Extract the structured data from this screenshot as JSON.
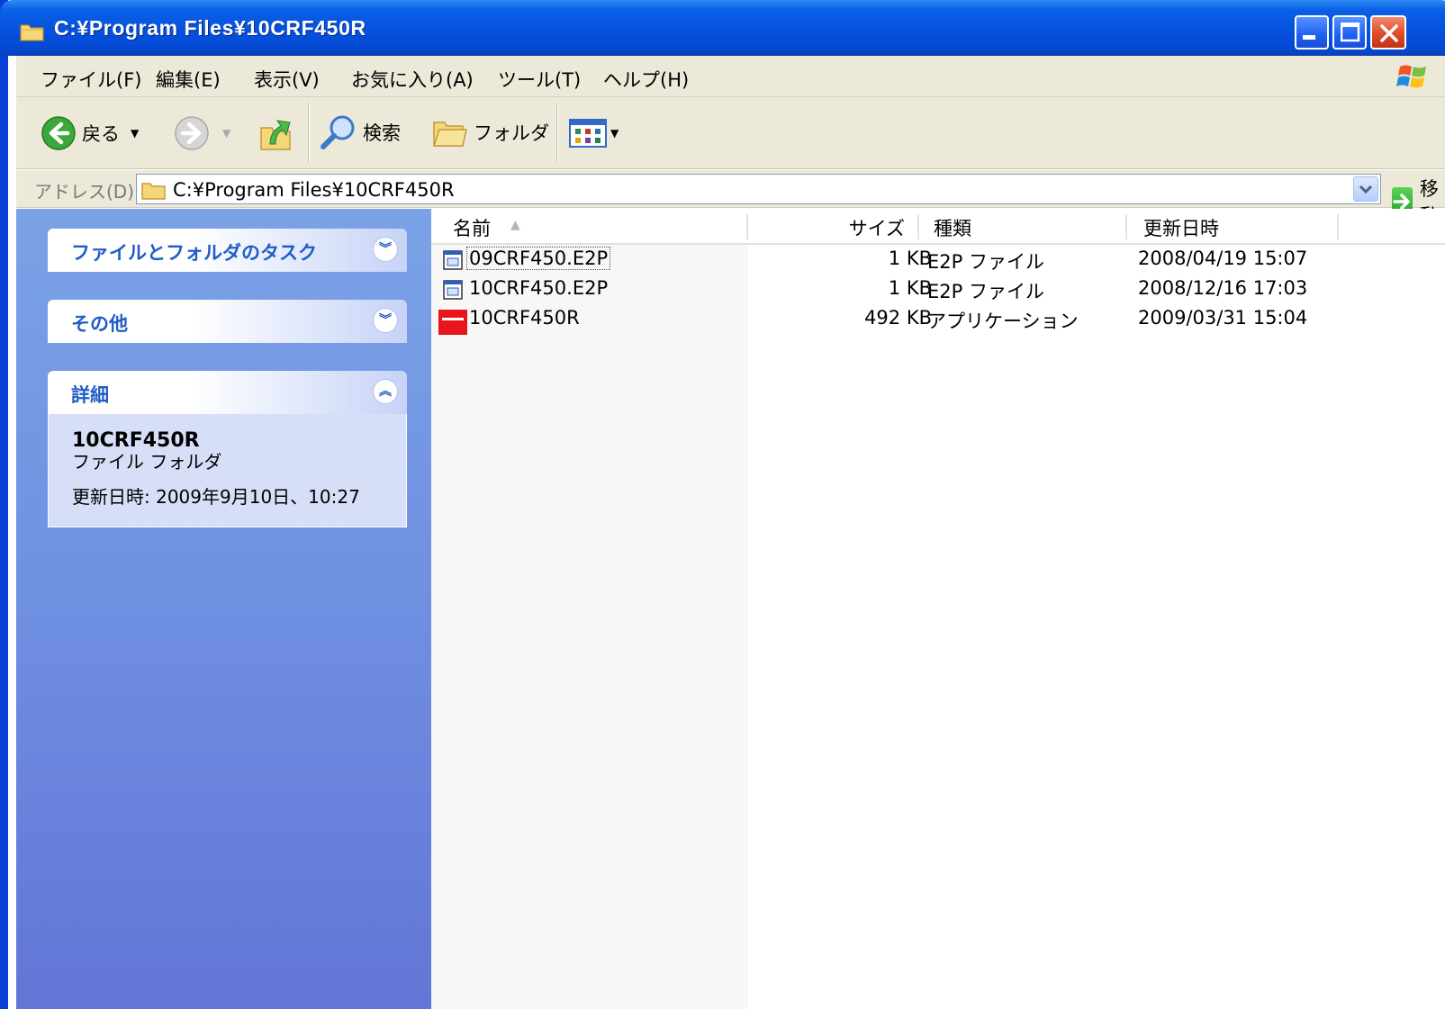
{
  "window": {
    "title": "C:¥Program Files¥10CRF450R"
  },
  "menu": {
    "items": [
      "ファイル(F)",
      "編集(E)",
      "表示(V)",
      "お気に入り(A)",
      "ツール(T)",
      "ヘルプ(H)"
    ]
  },
  "toolbar": {
    "back_label": "戻る",
    "search_label": "検索",
    "folders_label": "フォルダ"
  },
  "address": {
    "label": "アドレス(D)",
    "value": "C:¥Program Files¥10CRF450R",
    "go_label": "移動"
  },
  "taskpane": {
    "panels": [
      {
        "title": "ファイルとフォルダのタスク",
        "expanded": false
      },
      {
        "title": "その他",
        "expanded": false
      },
      {
        "title": "詳細",
        "expanded": true
      }
    ],
    "details": {
      "name": "10CRF450R",
      "type": "ファイル フォルダ",
      "modified": "更新日時: 2009年9月10日、10:27"
    }
  },
  "filelist": {
    "columns": [
      "名前",
      "サイズ",
      "種類",
      "更新日時"
    ],
    "files": [
      {
        "name": "09CRF450.E2P",
        "size": "1 KB",
        "type": "E2P ファイル",
        "modified": "2008/04/19 15:07",
        "icon": "e2p-file-icon"
      },
      {
        "name": "10CRF450.E2P",
        "size": "1 KB",
        "type": "E2P ファイル",
        "modified": "2008/12/16 17:03",
        "icon": "e2p-file-icon"
      },
      {
        "name": "10CRF450R",
        "size": "492 KB",
        "type": "アプリケーション",
        "modified": "2009/03/31 15:04",
        "icon": "application-icon"
      }
    ]
  },
  "colors": {
    "titlebar": "#0550dc",
    "taskpane": "#6f8fe1",
    "panel_title": "#215dc6",
    "close_button": "#e0492a"
  }
}
